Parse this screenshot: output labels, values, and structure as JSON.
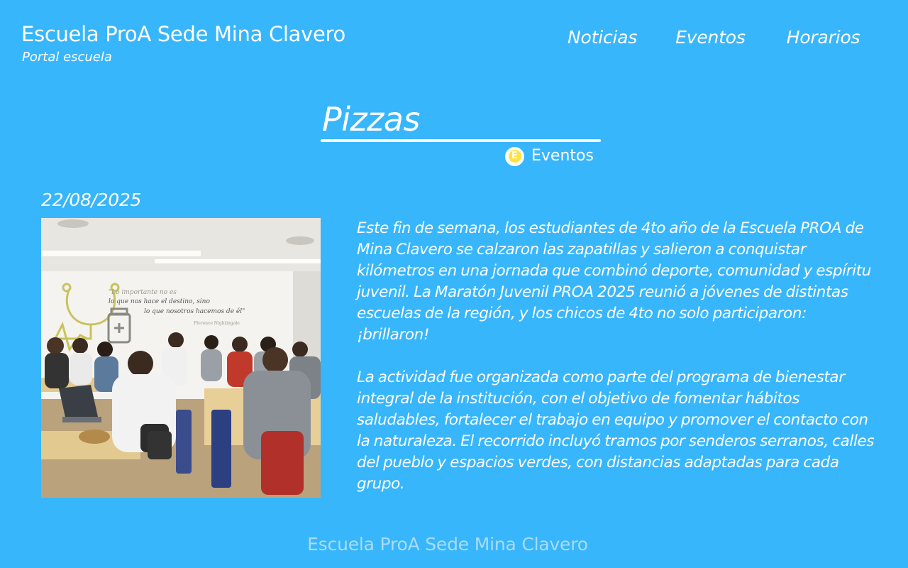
{
  "header": {
    "site_title": "Escuela ProA Sede Mina Clavero",
    "subtitle": "Portal escuela",
    "nav": [
      {
        "label": "Noticias"
      },
      {
        "label": "Eventos"
      },
      {
        "label": "Horarios"
      }
    ]
  },
  "post": {
    "title": "Pizzas",
    "category": {
      "label": "Eventos",
      "icon": "category-e-icon",
      "icon_letter": "E",
      "icon_color": "#ffe23b"
    },
    "date": "22/08/2025",
    "image": {
      "alt": "Estudiantes trabajando con computadoras en un aula",
      "wall_text_1": "\"Lo importante no es lo que nos hace el destino, sino lo que nosotros hacemos de él\"",
      "wall_text_2": "Florence Nightingale"
    },
    "paragraphs": [
      "Este fin de semana, los estudiantes de 4to año de la Escuela PROA de Mina Clavero se calzaron las zapatillas y salieron a conquistar kilómetros en una jornada que combinó deporte, comunidad y espíritu juvenil. La Maratón Juvenil PROA 2025 reunió a jóvenes de distintas escuelas de la región, y los chicos de 4to no solo participaron: ¡brillaron!",
      "La actividad fue organizada como parte del programa de bienestar integral de la institución, con el objetivo de fomentar hábitos saludables, fortalecer el trabajo en equipo y promover el contacto con la naturaleza. El recorrido incluyó tramos por senderos serranos, calles del pueblo y espacios verdes, con distancias adaptadas para cada grupo."
    ]
  },
  "footer": {
    "text": "Escuela ProA Sede Mina Clavero"
  },
  "colors": {
    "background": "#38b6fb",
    "text": "#ffffff",
    "footer_text": "#a9dcfb",
    "accent": "#ffe23b"
  }
}
